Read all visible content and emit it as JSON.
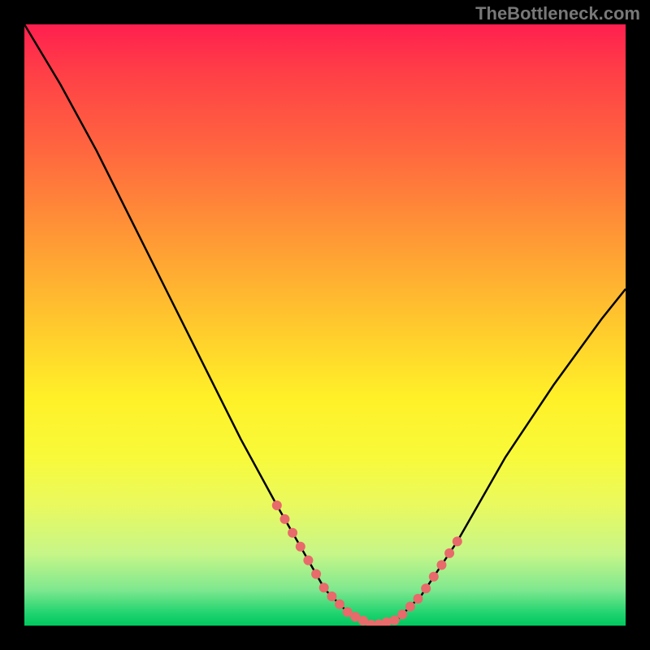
{
  "watermark": "TheBottleneck.com",
  "chart_data": {
    "type": "line",
    "title": "",
    "xlabel": "",
    "ylabel": "",
    "xlim": [
      0,
      100
    ],
    "ylim": [
      0,
      100
    ],
    "series": [
      {
        "name": "curve",
        "x": [
          0,
          6,
          12,
          18,
          24,
          30,
          36,
          42,
          46,
          50,
          54,
          58,
          62,
          66,
          72,
          80,
          88,
          96,
          100
        ],
        "values": [
          100,
          90,
          79,
          67,
          55,
          43,
          31,
          20,
          13,
          6,
          2,
          0,
          1,
          5,
          14,
          28,
          40,
          51,
          56
        ]
      }
    ],
    "dotted_region_x": [
      42,
      46,
      50,
      54,
      58,
      62,
      66,
      72
    ],
    "dot_color": "#e86a6a",
    "curve_color": "#000000",
    "gradient_stops": [
      {
        "pos": 0,
        "color": "#ff1f4f"
      },
      {
        "pos": 50,
        "color": "#ffc92d"
      },
      {
        "pos": 72,
        "color": "#f8fa3a"
      },
      {
        "pos": 100,
        "color": "#00c85e"
      }
    ]
  }
}
